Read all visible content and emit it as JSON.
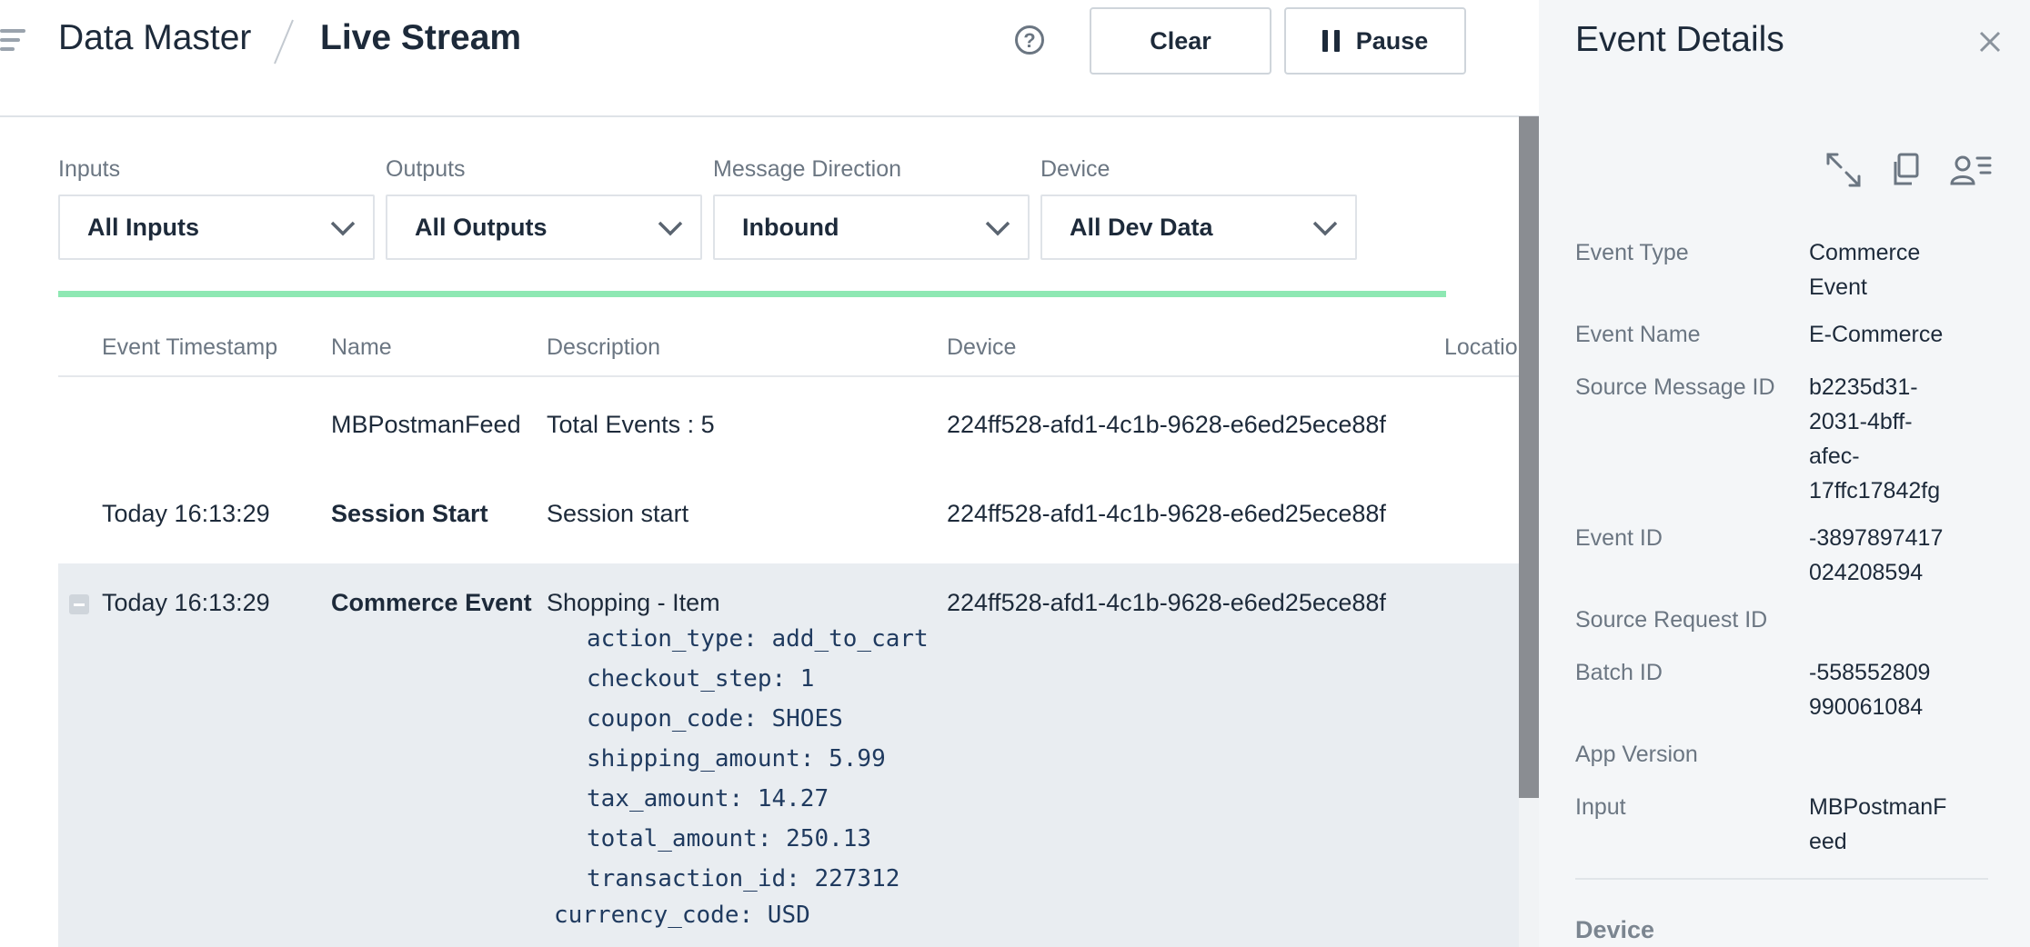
{
  "header": {
    "breadcrumb_root": "Data Master",
    "page_title": "Live Stream",
    "help_label": "?",
    "clear_label": "Clear",
    "pause_label": "Pause"
  },
  "filters": [
    {
      "label": "Inputs",
      "value": "All Inputs"
    },
    {
      "label": "Outputs",
      "value": "All Outputs"
    },
    {
      "label": "Message Direction",
      "value": "Inbound"
    },
    {
      "label": "Device",
      "value": "All Dev Data"
    }
  ],
  "stream_progress": 1.0,
  "table": {
    "columns": [
      "Event Timestamp",
      "Name",
      "Description",
      "Device",
      "Location"
    ],
    "rows": [
      {
        "timestamp": "",
        "name": "MBPostmanFeed",
        "description": "Total Events : 5",
        "device": "224ff528-afd1-4c1b-9628-e6ed25ece88f"
      },
      {
        "timestamp": "Today 16:13:29",
        "name": "Session Start",
        "description": "Session start",
        "device": "224ff528-afd1-4c1b-9628-e6ed25ece88f"
      },
      {
        "timestamp": "Today 16:13:29",
        "name": "Commerce Event",
        "description": "Shopping - Item",
        "device": "224ff528-afd1-4c1b-9628-e6ed25ece88f"
      }
    ],
    "expanded_attributes": [
      "action_type: add_to_cart",
      "checkout_step: 1",
      "coupon_code: SHOES",
      "shipping_amount: 5.99",
      "tax_amount: 14.27",
      "total_amount: 250.13",
      "transaction_id: 227312"
    ],
    "expanded_trailing": "currency_code: USD"
  },
  "panel": {
    "title": "Event Details",
    "close_label": "×",
    "fields": [
      {
        "label": "Event Type",
        "value": "Commerce\nEvent"
      },
      {
        "label": "Event Name",
        "value": "E-Commerce"
      },
      {
        "label": "Source Message ID",
        "value": "b2235d31-\n2031-4bff-\nafec-\n17ffc17842fg"
      },
      {
        "label": "Event ID",
        "value": "-3897897417\n024208594"
      },
      {
        "label": "Source Request ID",
        "value": ""
      },
      {
        "label": "Batch ID",
        "value": "-558552809\n990061084"
      },
      {
        "label": "App Version",
        "value": ""
      },
      {
        "label": "Input",
        "value": "MBPostmanF\need"
      }
    ],
    "section": "Device"
  },
  "icons": {
    "menu": "hamburger-icon",
    "help": "help-icon",
    "pause": "pause-icon",
    "chevron": "chevron-down-icon",
    "expand": "expand-icon",
    "copy": "copy-icon",
    "user_list": "user-list-icon",
    "close": "close-icon",
    "collapse": "collapse-icon"
  },
  "colors": {
    "text": "#1d2a3a",
    "muted": "#6b7682",
    "progress": "#8ee8b3",
    "expanded_row": "#e9edf1",
    "panel_bg": "#f4f6f8",
    "attribute_text": "#1f3a5f"
  }
}
